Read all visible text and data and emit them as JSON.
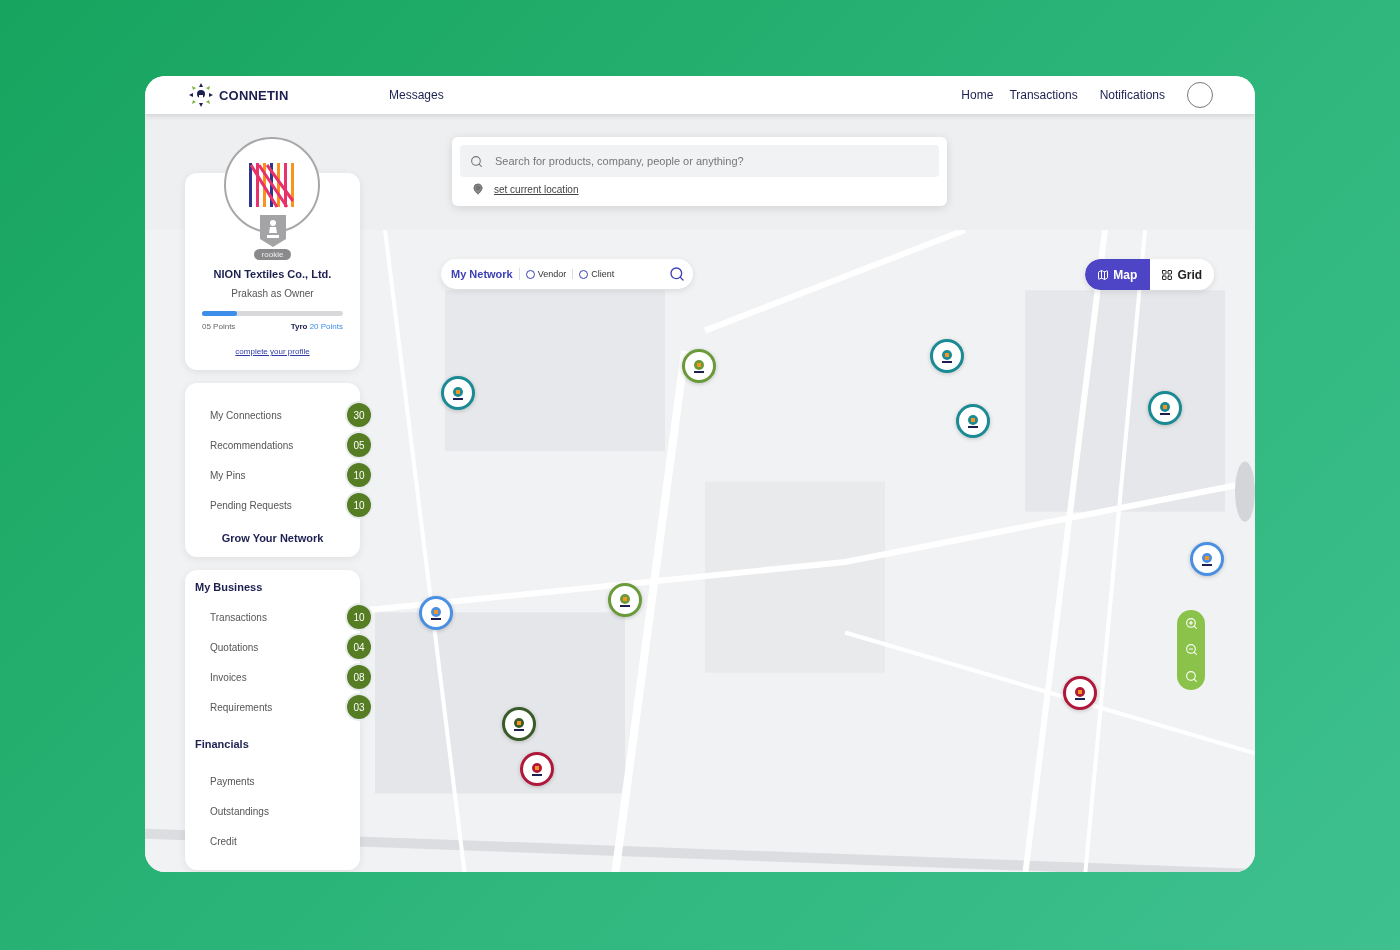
{
  "header": {
    "logo": "CONNETIN",
    "nav_left": [
      "Messages"
    ],
    "nav_right": [
      "Home",
      "Transactions",
      "Notifications"
    ]
  },
  "search": {
    "placeholder": "Search for products, company, people or anything?",
    "location_link": "set current location"
  },
  "profile": {
    "company": "NION Textiles Co., Ltd.",
    "role": "Prakash as Owner",
    "badge": "rookie",
    "points": "05 Points",
    "level_name": "Tyro",
    "level_points": "20 Points",
    "level": 0.25,
    "link": "complete your profile"
  },
  "network": {
    "items": [
      {
        "label": "My Connections",
        "count": "30"
      },
      {
        "label": "Recommendations",
        "count": "05"
      },
      {
        "label": "My Pins",
        "count": "10"
      },
      {
        "label": "Pending Requests",
        "count": "10"
      }
    ],
    "action": "Grow Your Network"
  },
  "business": [
    {
      "title": "My Business",
      "items": [
        {
          "label": "Transactions",
          "count": "10"
        },
        {
          "label": "Quotations",
          "count": "04"
        },
        {
          "label": "Invoices",
          "count": "08"
        },
        {
          "label": "Requirements",
          "count": "03"
        }
      ]
    },
    {
      "title": "Financials",
      "items": [
        {
          "label": "Payments"
        },
        {
          "label": "Outstandings"
        },
        {
          "label": "Credit"
        }
      ]
    }
  ],
  "filter": {
    "title": "My Network",
    "options": [
      {
        "label": "Vendor",
        "selected": false
      },
      {
        "label": "Client",
        "selected": false
      }
    ]
  },
  "view_toggle": [
    {
      "label": "Map",
      "selected": true
    },
    {
      "label": "Grid",
      "selected": false
    }
  ],
  "markers": [
    {
      "color": "#1a8a94"
    },
    {
      "color": "#6a9a3a"
    },
    {
      "color": "#1a8a94"
    },
    {
      "color": "#1a8a94"
    },
    {
      "color": "#1a8a94"
    },
    {
      "color": "#4a90e2"
    },
    {
      "color": "#6a9a3a"
    },
    {
      "color": "#4a90e2"
    },
    {
      "color": "#3a5a2a"
    },
    {
      "color": "#b0173a"
    },
    {
      "color": "#b0173a"
    }
  ]
}
